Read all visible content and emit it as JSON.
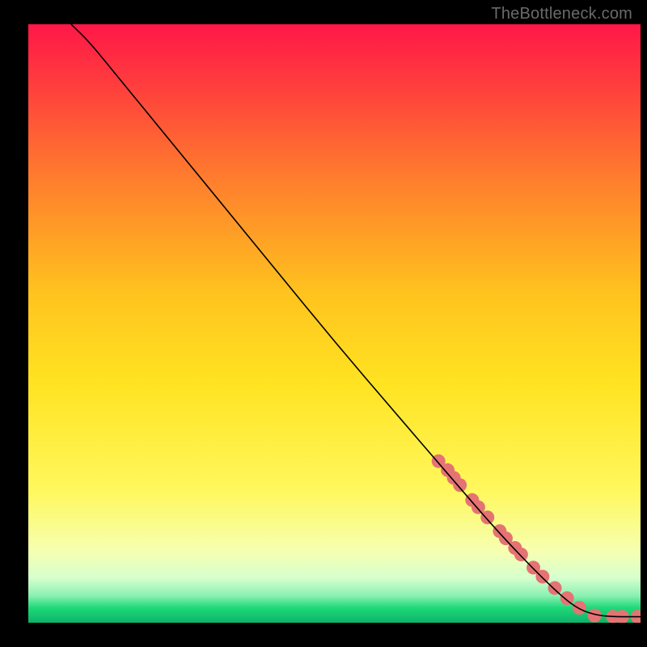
{
  "watermark": {
    "text": "TheBottleneck.com"
  },
  "colors": {
    "marker": "#e57373",
    "line": "#000000",
    "black": "#000000",
    "gradient_stops": [
      {
        "offset": 0.0,
        "color": "#ff1748"
      },
      {
        "offset": 0.1,
        "color": "#ff3d3d"
      },
      {
        "offset": 0.25,
        "color": "#ff7a2e"
      },
      {
        "offset": 0.45,
        "color": "#ffc31e"
      },
      {
        "offset": 0.6,
        "color": "#ffe321"
      },
      {
        "offset": 0.78,
        "color": "#fff85e"
      },
      {
        "offset": 0.88,
        "color": "#f6ffb0"
      },
      {
        "offset": 0.925,
        "color": "#d7ffce"
      },
      {
        "offset": 0.955,
        "color": "#8af0b2"
      },
      {
        "offset": 0.975,
        "color": "#1ed97a"
      },
      {
        "offset": 1.0,
        "color": "#0db268"
      }
    ]
  },
  "chart_data": {
    "type": "line",
    "title": "",
    "xlabel": "",
    "ylabel": "",
    "xlim": [
      0,
      100
    ],
    "ylim": [
      0,
      100
    ],
    "grid": false,
    "series": [
      {
        "name": "curve",
        "x": [
          7,
          10,
          14,
          20,
          30,
          40,
          50,
          60,
          68,
          76,
          82,
          87,
          90,
          93,
          96,
          100
        ],
        "y": [
          100,
          97,
          92,
          84.5,
          72,
          59.5,
          47,
          35,
          25.5,
          16,
          9.5,
          4.5,
          2.2,
          1.2,
          1.0,
          1.0
        ]
      }
    ],
    "markers": {
      "name": "highlighted-points",
      "x": [
        67,
        68.5,
        69.5,
        70.5,
        72.5,
        73.5,
        75,
        77,
        78,
        79.5,
        80.5,
        82.5,
        84,
        86,
        88,
        90,
        92.5,
        95.5,
        97,
        99.5
      ],
      "y": [
        27,
        25.5,
        24.2,
        23,
        20.5,
        19.3,
        17.6,
        15.3,
        14.1,
        12.5,
        11.4,
        9.2,
        7.7,
        5.8,
        4.1,
        2.5,
        1.2,
        1.0,
        1.0,
        1.0
      ]
    }
  }
}
